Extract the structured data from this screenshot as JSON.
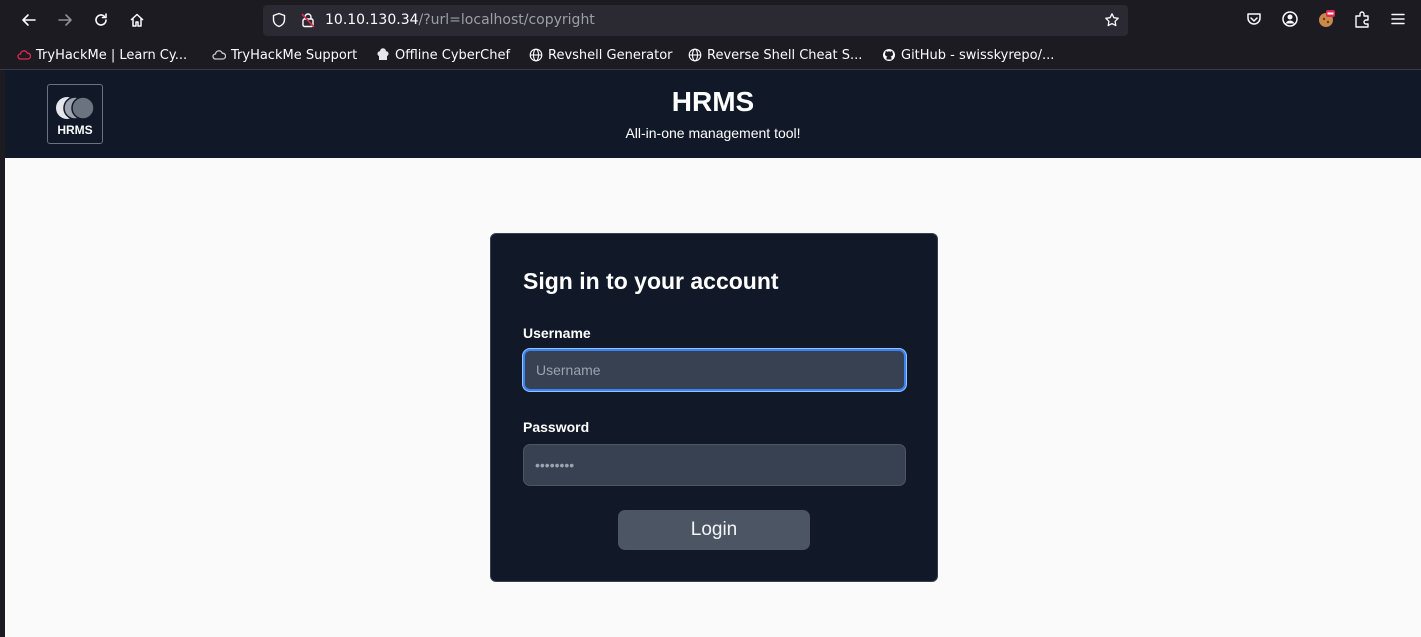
{
  "browser": {
    "url_host": "10.10.130.34",
    "url_path": "/?url=localhost/copyright",
    "bookmarks": [
      {
        "label": "TryHackMe | Learn Cy..."
      },
      {
        "label": "TryHackMe Support"
      },
      {
        "label": "Offline CyberChef"
      },
      {
        "label": "Revshell Generator"
      },
      {
        "label": "Reverse Shell Cheat S..."
      },
      {
        "label": "GitHub - swisskyrepo/..."
      }
    ]
  },
  "site": {
    "logo_text": "HRMS",
    "title": "HRMS",
    "tagline": "All-in-one management tool!"
  },
  "login": {
    "heading": "Sign in to your account",
    "username_label": "Username",
    "username_placeholder": "Username",
    "username_value": "",
    "password_label": "Password",
    "password_placeholder": "••••••••",
    "button_label": "Login"
  },
  "colors": {
    "header_bg": "#111827",
    "card_bg": "#111827",
    "input_bg": "#374151",
    "button_bg": "#4b5563",
    "focus_ring": "#3b82f6",
    "page_bg": "#fafafa"
  }
}
